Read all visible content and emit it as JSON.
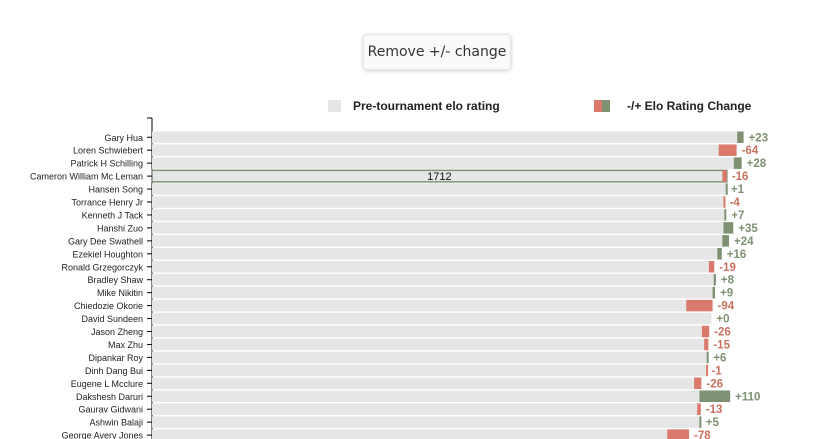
{
  "controls": {
    "toggle_label": "Remove +/- change"
  },
  "legend": {
    "base_label": "Pre-tournament elo rating",
    "change_label": "-/+ Elo Rating Change"
  },
  "colors": {
    "base": "#e6e6e6",
    "positive": "#7e9172",
    "negative": "#db7a6c",
    "positive_text": "#7e9172",
    "negative_text": "#c9715f",
    "highlight_border": "#7e9172"
  },
  "chart_data": {
    "type": "bar",
    "orientation": "horizontal",
    "highlighted_player": "Cameron William Mc Leman",
    "highlighted_value_label": "1712",
    "xlim": [
      0,
      2120
    ],
    "categories": [
      "Gary Hua",
      "Loren Schwiebert",
      "Patrick H Schilling",
      "Cameron William Mc Leman",
      "Hansen Song",
      "Torrance Henry Jr",
      "Kenneth J Tack",
      "Hanshi Zuo",
      "Gary Dee Swathell",
      "Ezekiel Houghton",
      "Ronald Grzegorczyk",
      "Bradley Shaw",
      "Mike Nikitin",
      "Chiedozie Okorie",
      "David Sundeen",
      "Jason Zheng",
      "Max Zhu",
      "Dipankar Roy",
      "Dinh Dang Bui",
      "Eugene L Mcclure",
      "Dakshesh Daruri",
      "Gaurav Gidwani",
      "Ashwin Balaji",
      "George Avery Jones"
    ],
    "series": [
      {
        "name": "Pre-tournament elo rating",
        "values": [
          2092,
          2090,
          2080,
          2055,
          2051,
          2047,
          2046,
          2043,
          2039,
          2021,
          2010,
          2008,
          2004,
          2004,
          2000,
          1992,
          1989,
          1983,
          1982,
          1964,
          1957,
          1962,
          1957,
          1920
        ]
      },
      {
        "name": "-/+ Elo Rating Change",
        "values": [
          23,
          -64,
          28,
          -16,
          1,
          -4,
          7,
          35,
          24,
          16,
          -19,
          8,
          9,
          -94,
          0,
          -26,
          -15,
          6,
          -1,
          -26,
          110,
          -13,
          5,
          -78
        ]
      }
    ],
    "change_labels": [
      "+23",
      "-64",
      "+28",
      "-16",
      "+1",
      "-4",
      "+7",
      "+35",
      "+24",
      "+16",
      "-19",
      "+8",
      "+9",
      "-94",
      "+0",
      "-26",
      "-15",
      "+6",
      "-1",
      "-26",
      "+110",
      "-13",
      "+5",
      "-78"
    ]
  }
}
